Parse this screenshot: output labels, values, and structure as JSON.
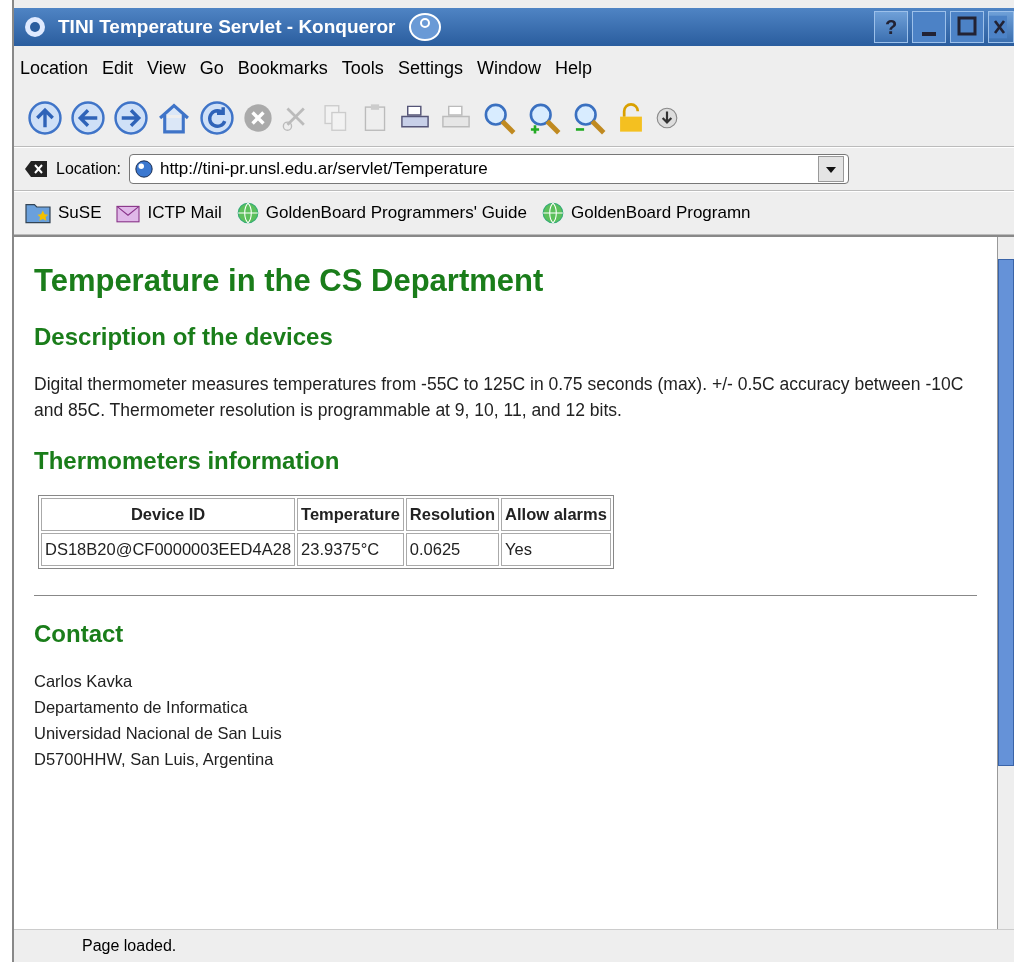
{
  "window": {
    "title": "TINI Temperature Servlet - Konqueror",
    "controls": [
      "?"
    ]
  },
  "menu": [
    "Location",
    "Edit",
    "View",
    "Go",
    "Bookmarks",
    "Tools",
    "Settings",
    "Window",
    "Help"
  ],
  "toolbar": [
    {
      "kind": "up"
    },
    {
      "kind": "back"
    },
    {
      "kind": "forward"
    },
    {
      "kind": "home"
    },
    {
      "kind": "reload"
    },
    {
      "kind": "stop"
    },
    {
      "kind": "cut"
    },
    {
      "kind": "copy"
    },
    {
      "kind": "paste"
    },
    {
      "kind": "print"
    },
    {
      "kind": "printframe"
    },
    {
      "kind": "find"
    },
    {
      "kind": "zoomin"
    },
    {
      "kind": "zoomout"
    },
    {
      "kind": "lock"
    },
    {
      "kind": "download"
    }
  ],
  "location": {
    "label": "Location:",
    "value": "http://tini-pr.unsl.edu.ar/servlet/Temperature"
  },
  "bookmarks": [
    {
      "label": "SuSE",
      "kind": "folder"
    },
    {
      "label": "ICTP Mail",
      "kind": "mail"
    },
    {
      "label": "GoldenBoard Programmers' Guide",
      "kind": "page"
    },
    {
      "label": "GoldenBoard Programn",
      "kind": "page"
    }
  ],
  "page": {
    "title": "Temperature in the CS Department",
    "sections": [
      {
        "heading": "Description of the devices",
        "paragraph": "Digital thermometer measures temperatures from -55C to 125C in 0.75 seconds (max). +/- 0.5C accuracy between -10C and 85C. Thermometer resolution is programmable at 9, 10, 11, and 12 bits."
      },
      {
        "heading": "Thermometers information",
        "table": {
          "columns": [
            "Device ID",
            "Temperature",
            "Resolution",
            "Allow alarms"
          ],
          "rows": [
            [
              "DS18B20@CF0000003EED4A28",
              "23.9375°C",
              "0.0625",
              "Yes"
            ]
          ]
        }
      },
      {
        "heading": "Contact",
        "lines": [
          "Carlos Kavka",
          "Departamento de Informatica",
          "Universidad Nacional de San Luis",
          "D5700HHW, San Luis, Argentina"
        ]
      }
    ]
  },
  "status_bar": "Page loaded."
}
